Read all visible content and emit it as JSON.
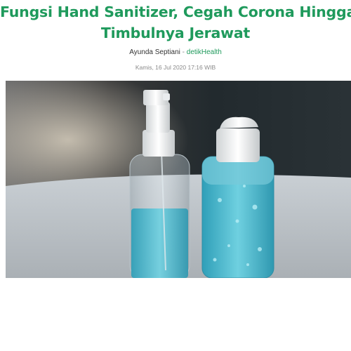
{
  "article": {
    "title_line1": "Fungsi Hand Sanitizer, Cegah Corona Hingga",
    "title_line2": "Timbulnya Jerawat",
    "author": "Ayunda Septiani",
    "separator": "-",
    "channel": "detikHealth",
    "date": "Kamis, 16 Jul 2020 17:16 WIB"
  },
  "colors": {
    "title": "#1f9a5c",
    "channel": "#1f9a5c",
    "date": "#8a8a8a",
    "gel": "#4fb9cf"
  },
  "hero_image": {
    "subject": "two-sanitizer-bottles",
    "items": [
      "spray-bottle",
      "flip-cap-bottle"
    ]
  }
}
